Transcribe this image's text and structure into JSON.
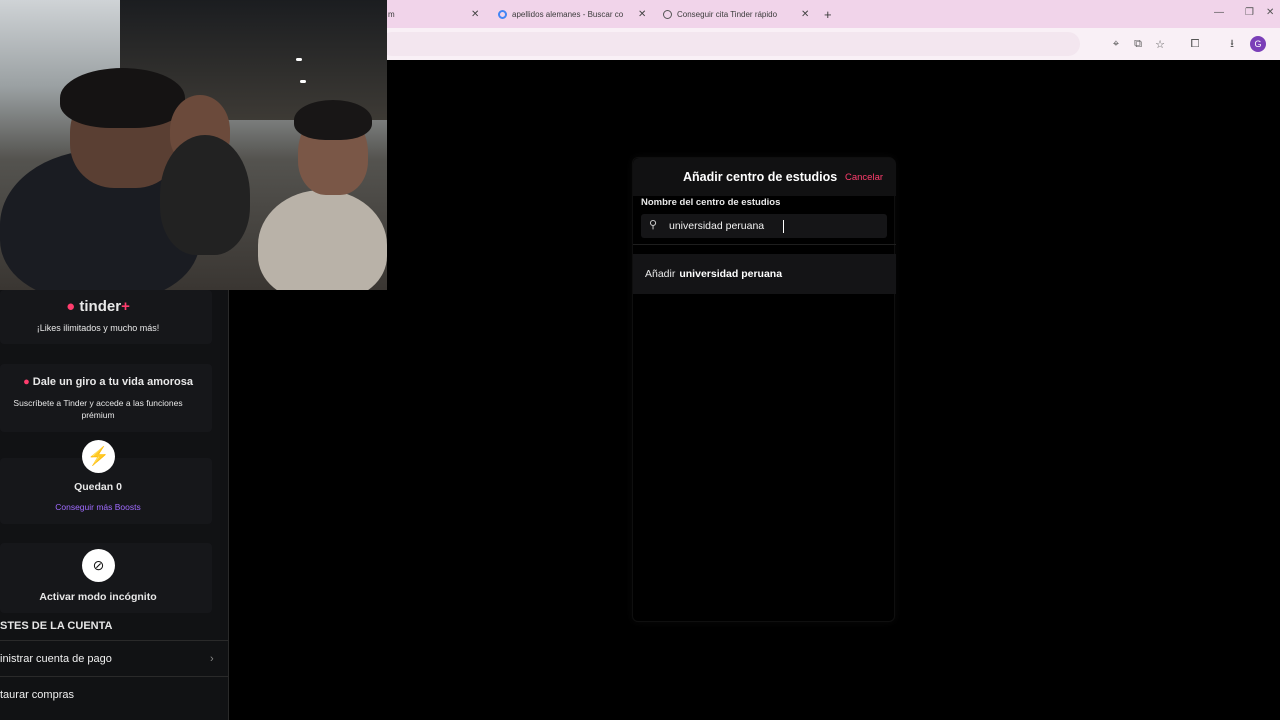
{
  "browser": {
    "tabs": [
      {
        "title": "m"
      },
      {
        "title": "apellidos alemanes - Buscar co"
      },
      {
        "title": "Conseguir cita Tinder rápido"
      }
    ],
    "new_tab": "+",
    "profile_initial": "G"
  },
  "sidebar": {
    "tinder_plus": {
      "logo": "tinder",
      "plus": "+",
      "subtitle": "¡Likes ilimitados y mucho más!"
    },
    "promo": {
      "title": "Dale un giro a tu vida amorosa",
      "text": "Suscríbete a Tinder y accede a las funciones prémium"
    },
    "boosts": {
      "remaining": "Quedan 0",
      "link": "Conseguir más Boosts"
    },
    "incognito": {
      "label": "Activar modo incógnito"
    },
    "account_settings_header": "STES DE LA CUENTA",
    "rows": [
      {
        "label": "inistrar cuenta de pago"
      },
      {
        "label": "taurar compras"
      }
    ]
  },
  "modal": {
    "title": "Añadir centro de estudios",
    "cancel": "Cancelar",
    "field_label": "Nombre del centro de estudios",
    "search_value": "universidad peruana",
    "suggestion_prefix": "Añadir",
    "suggestion_value": "universidad peruana"
  },
  "colors": {
    "accent": "#ff3d6d",
    "boost": "#8b3dff",
    "background": "#000000"
  }
}
